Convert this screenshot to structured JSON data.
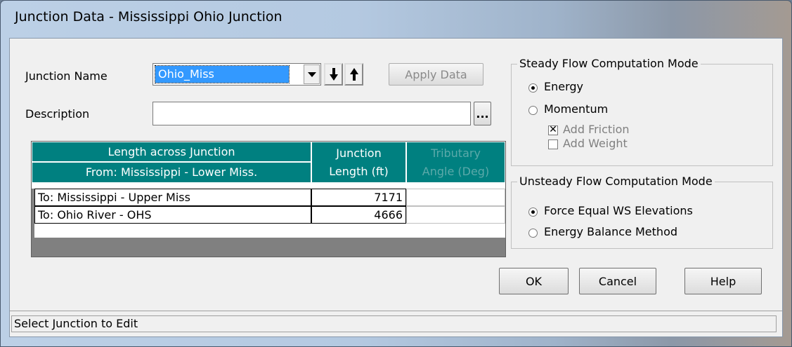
{
  "window": {
    "title": "Junction Data - Mississippi Ohio Junction"
  },
  "form": {
    "junction_name_label": "Junction Name",
    "junction_name_value": "Ohio_Miss",
    "description_label": "Description",
    "description_value": "",
    "description_button": "...",
    "apply_button": "Apply Data",
    "down_arrow_icon": "down-arrow-icon",
    "up_arrow_icon": "up-arrow-icon"
  },
  "table": {
    "header_length_across": "Length across Junction",
    "header_from": "From: Mississippi - Lower Miss.",
    "header_junction": "Junction",
    "header_length_ft": "Length (ft)",
    "header_tributary": "Tributary",
    "header_angle": "Angle (Deg)",
    "rows": [
      {
        "to": "To: Mississippi - Upper Miss",
        "length": "7171",
        "angle": ""
      },
      {
        "to": "To: Ohio River - OHS",
        "length": "4666",
        "angle": ""
      }
    ],
    "header_color": "#008080"
  },
  "steady": {
    "title": "Steady Flow Computation Mode",
    "energy_label": "Energy",
    "energy_selected": true,
    "momentum_label": "Momentum",
    "momentum_selected": false,
    "add_friction_label": "Add Friction",
    "add_friction_checked": true,
    "add_weight_label": "Add Weight",
    "add_weight_checked": false
  },
  "unsteady": {
    "title": "Unsteady Flow Computation Mode",
    "force_equal_label": "Force Equal WS Elevations",
    "force_equal_selected": true,
    "energy_balance_label": "Energy Balance Method",
    "energy_balance_selected": false
  },
  "buttons": {
    "ok": "OK",
    "cancel": "Cancel",
    "help": "Help"
  },
  "status": {
    "text": "Select Junction to Edit"
  }
}
